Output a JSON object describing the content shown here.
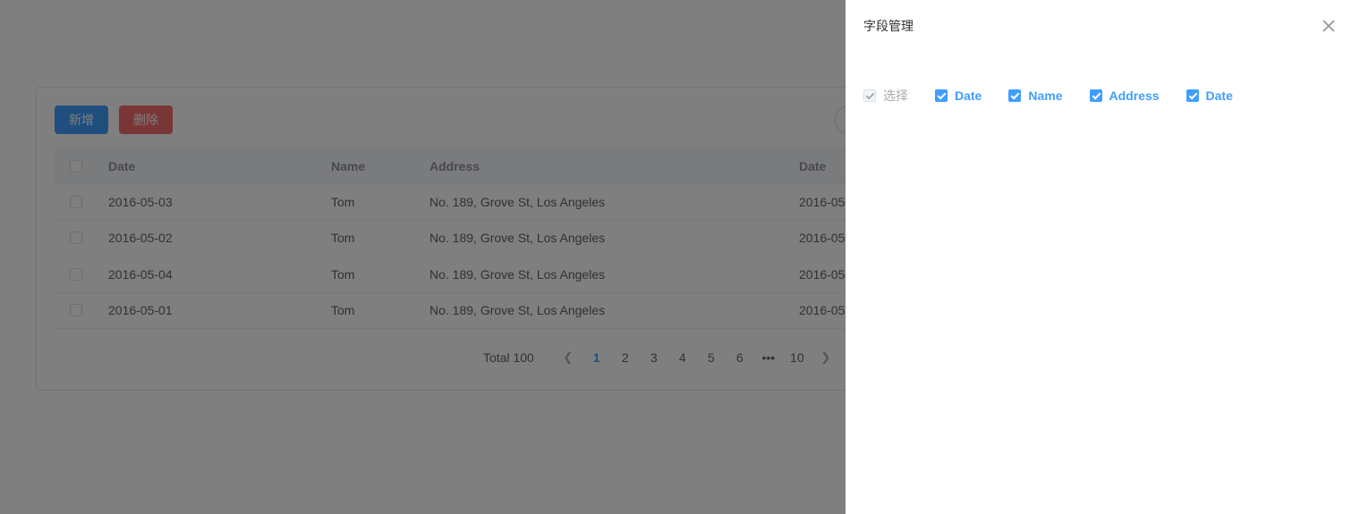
{
  "toolbar": {
    "add_label": "新增",
    "delete_label": "删除"
  },
  "table": {
    "headers": {
      "date": "Date",
      "name": "Name",
      "address": "Address",
      "date2": "Date"
    },
    "rows": [
      {
        "date": "2016-05-03",
        "name": "Tom",
        "address": "No. 189, Grove St, Los Angeles",
        "date2": "2016-05"
      },
      {
        "date": "2016-05-02",
        "name": "Tom",
        "address": "No. 189, Grove St, Los Angeles",
        "date2": "2016-05"
      },
      {
        "date": "2016-05-04",
        "name": "Tom",
        "address": "No. 189, Grove St, Los Angeles",
        "date2": "2016-05"
      },
      {
        "date": "2016-05-01",
        "name": "Tom",
        "address": "No. 189, Grove St, Los Angeles",
        "date2": "2016-05"
      }
    ]
  },
  "pagination": {
    "total": "Total 100",
    "pages": [
      "1",
      "2",
      "3",
      "4",
      "5",
      "6",
      "•••",
      "10"
    ],
    "current": "1"
  },
  "drawer": {
    "title": "字段管理",
    "fields": [
      {
        "label": "选择",
        "checked": true,
        "disabled": true
      },
      {
        "label": "Date",
        "checked": true,
        "disabled": false
      },
      {
        "label": "Name",
        "checked": true,
        "disabled": false
      },
      {
        "label": "Address",
        "checked": true,
        "disabled": false
      },
      {
        "label": "Date",
        "checked": true,
        "disabled": false
      }
    ]
  },
  "colors": {
    "primary": "#409eff",
    "danger": "#f56c6c",
    "mask": "rgba(0,0,0,0.5)"
  },
  "icons": {
    "close": "close-icon",
    "prev": "chevron-left-icon",
    "next": "chevron-right-icon",
    "check": "check-icon"
  }
}
